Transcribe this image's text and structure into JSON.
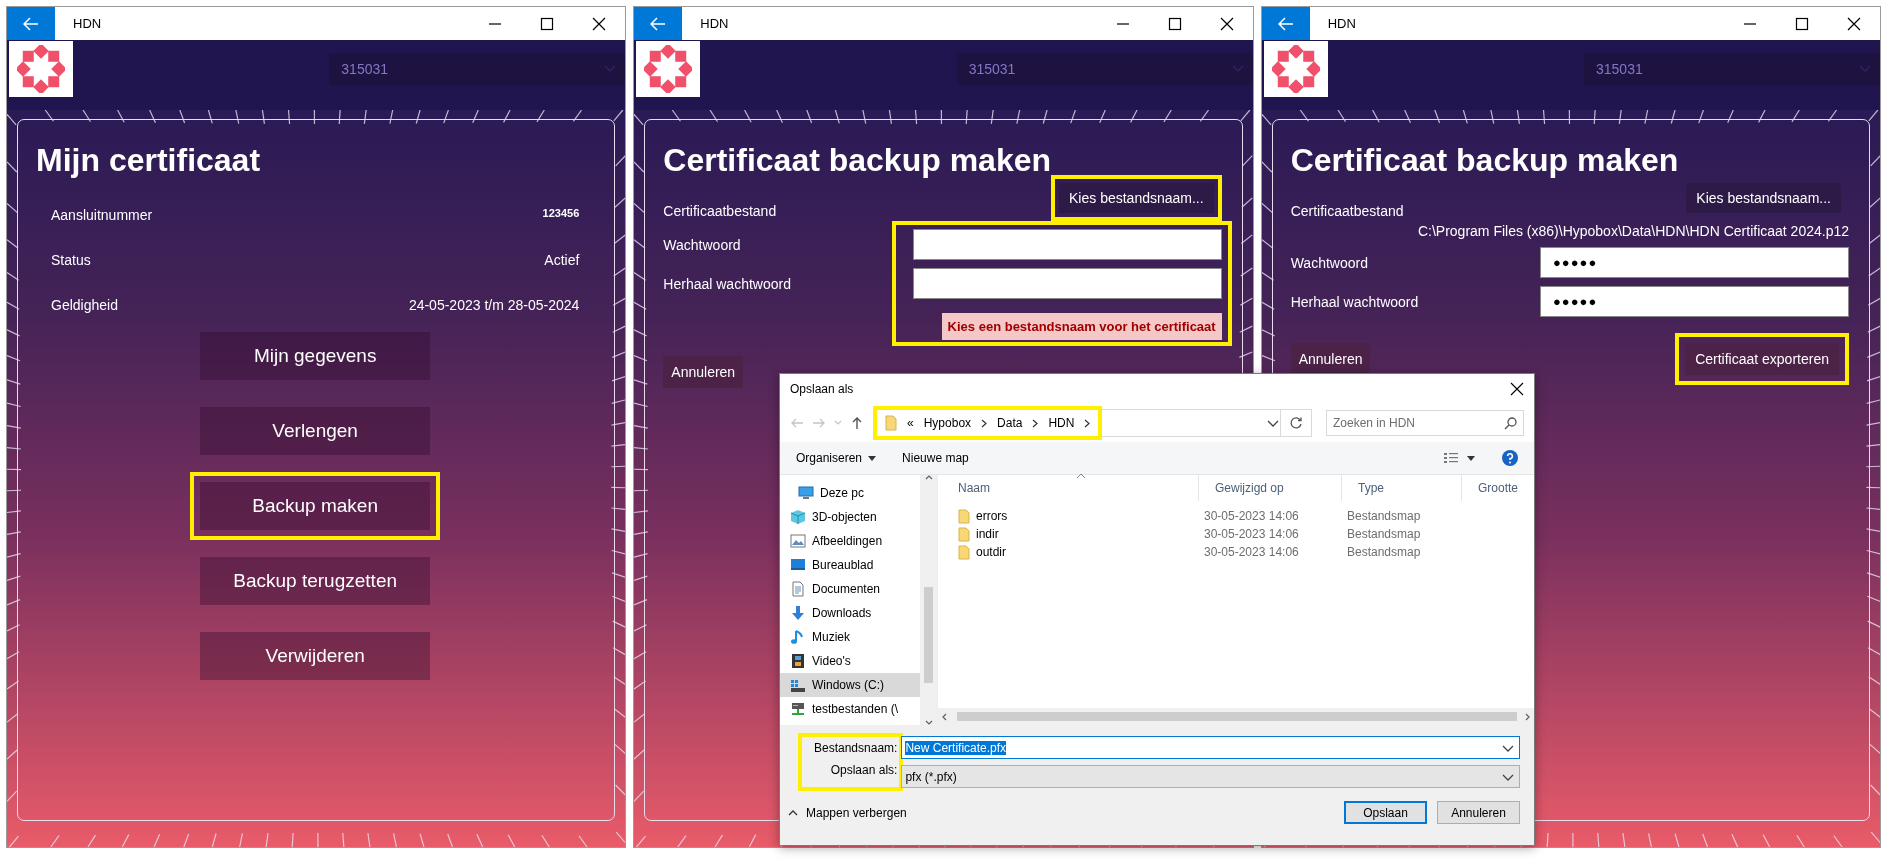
{
  "windows": [
    {
      "title": "HDN",
      "account": "315031",
      "screen": {
        "kind": "menu",
        "heading": "Mijn certificaat",
        "details": [
          {
            "label": "Aansluitnummer",
            "value": "123456",
            "emphasis": true
          },
          {
            "label": "Status",
            "value": "Actief",
            "emphasis": false
          },
          {
            "label": "Geldigheid",
            "value": "24-05-2023 t/m 28-05-2024",
            "emphasis": false
          }
        ],
        "buttons": [
          {
            "label": "Mijn gegevens",
            "highlighted": false
          },
          {
            "label": "Verlengen",
            "highlighted": false
          },
          {
            "label": "Backup maken",
            "highlighted": true
          },
          {
            "label": "Backup terugzetten",
            "highlighted": false
          },
          {
            "label": "Verwijderen",
            "highlighted": false
          }
        ]
      }
    },
    {
      "title": "HDN",
      "account": "315031",
      "screen": {
        "kind": "backup",
        "heading": "Certificaat backup maken",
        "file_label": "Certificaatbestand",
        "choose_button": {
          "label": "Kies bestandsnaam...",
          "highlighted": true
        },
        "fields": [
          {
            "label": "Wachtwoord"
          },
          {
            "label": "Herhaal wachtwoord"
          }
        ],
        "fields_highlighted": true,
        "error": "Kies een bestandsnaam voor het certificaat",
        "cancel_button": "Annuleren"
      }
    },
    {
      "title": "HDN",
      "account": "315031",
      "screen": {
        "kind": "backup",
        "heading": "Certificaat backup maken",
        "file_label": "Certificaatbestand",
        "choose_button": {
          "label": "Kies bestandsnaam...",
          "highlighted": false
        },
        "file_path": "C:\\Program Files (x86)\\Hypobox\\Data\\HDN\\HDN Certificaat 2024.p12",
        "fields": [
          {
            "label": "Wachtwoord",
            "value": "●●●●●"
          },
          {
            "label": "Herhaal wachtwoord",
            "value": "●●●●●"
          }
        ],
        "fields_highlighted": false,
        "cancel_button": "Annuleren",
        "export_button": {
          "label": "Certificaat exporteren",
          "highlighted": true
        }
      }
    }
  ],
  "dialog": {
    "title": "Opslaan als",
    "address": {
      "overflow_mark": "«",
      "path": [
        "Hypobox",
        "Data",
        "HDN"
      ],
      "highlighted": true
    },
    "search_placeholder": "Zoeken in HDN",
    "toolbar": {
      "organize": "Organiseren",
      "new_folder": "Nieuwe map"
    },
    "tree": [
      {
        "label": "Deze pc",
        "kind": "pc",
        "selected": false,
        "children": [
          {
            "label": "3D-objecten",
            "kind": "cube",
            "selected": false
          },
          {
            "label": "Afbeeldingen",
            "kind": "image",
            "selected": false
          },
          {
            "label": "Bureaublad",
            "kind": "desktop",
            "selected": false
          },
          {
            "label": "Documenten",
            "kind": "document",
            "selected": false
          },
          {
            "label": "Downloads",
            "kind": "download",
            "selected": false
          },
          {
            "label": "Muziek",
            "kind": "music",
            "selected": false
          },
          {
            "label": "Video's",
            "kind": "film",
            "selected": false
          },
          {
            "label": "Windows  (C:)",
            "kind": "drive",
            "selected": true
          },
          {
            "label": "testbestanden (\\",
            "kind": "network",
            "selected": false
          }
        ]
      }
    ],
    "columns": [
      "Naam",
      "Gewijzigd op",
      "Type",
      "Grootte"
    ],
    "rows": [
      {
        "name": "errors",
        "modified": "30-05-2023 14:06",
        "type": "Bestandsmap"
      },
      {
        "name": "indir",
        "modified": "30-05-2023 14:06",
        "type": "Bestandsmap"
      },
      {
        "name": "outdir",
        "modified": "30-05-2023 14:06",
        "type": "Bestandsmap"
      }
    ],
    "filename": {
      "label": "Bestandsnaam:",
      "value": "New Certificate.pfx",
      "text_selected": true
    },
    "filetype": {
      "label": "Opslaan als:",
      "value": "pfx (*.pfx)"
    },
    "labels_highlighted": true,
    "hide_folders": "Mappen verbergen",
    "buttons": [
      {
        "label": "Opslaan",
        "default": true
      },
      {
        "label": "Annuleren",
        "default": false
      }
    ]
  }
}
